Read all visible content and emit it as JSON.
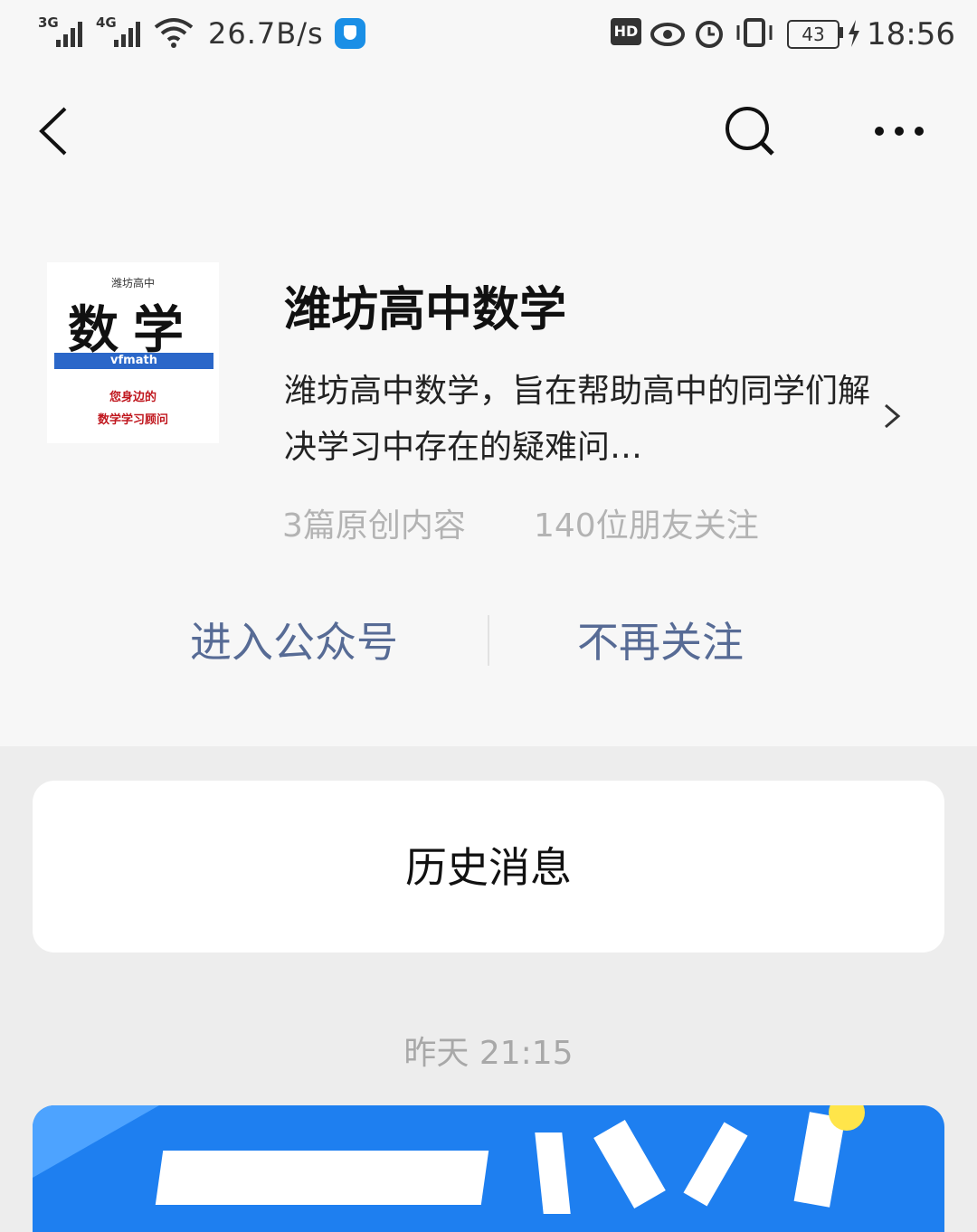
{
  "status_bar": {
    "net1": "3G",
    "net2": "4G",
    "speed": "26.7B/s",
    "hd": "HD",
    "battery": "43",
    "time": "18:56"
  },
  "nav": {
    "back_icon": "chevron-left-icon",
    "search_icon": "search-icon",
    "more_icon": "more-dots-icon"
  },
  "logo": {
    "top_text": "潍坊高中",
    "main_text": "数学",
    "bar_text": "vfmath",
    "red_line1": "您身边的",
    "red_line2": "数学学习顾问"
  },
  "account": {
    "name": "潍坊高中数学",
    "description": "潍坊高中数学，旨在帮助高中的同学们解决学习中存在的疑难问…",
    "original_count": "3篇原创内容",
    "followers": "140位朋友关注"
  },
  "actions": {
    "enter": "进入公众号",
    "unfollow": "不再关注"
  },
  "history": {
    "label": "历史消息"
  },
  "message": {
    "time": "昨天 21:15"
  },
  "colors": {
    "link": "#576b95",
    "article_blue": "#1e7ff0"
  }
}
